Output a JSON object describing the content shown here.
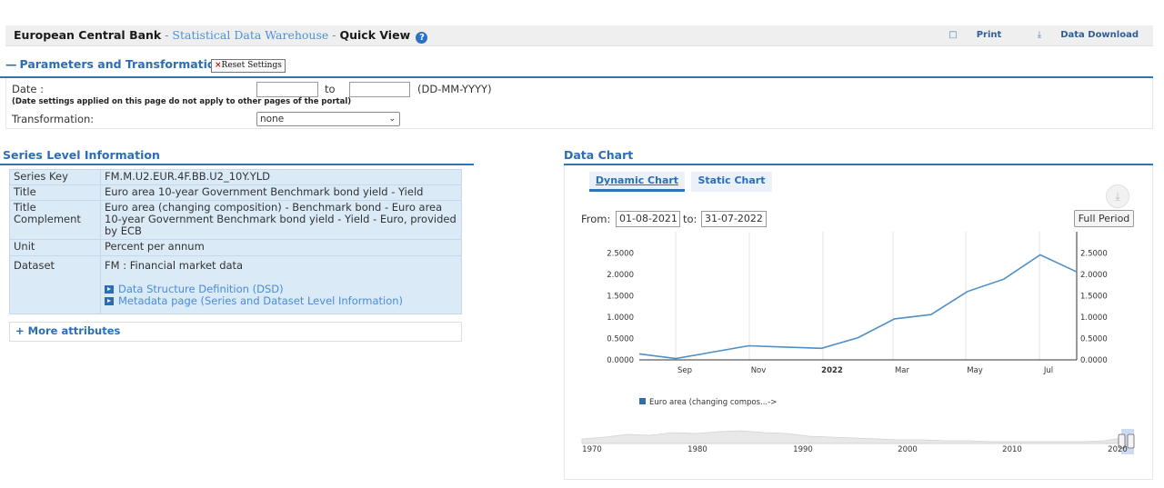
{
  "header": {
    "ecb": "European Central Bank",
    "sep1": " - ",
    "sdw": "Statistical Data Warehouse",
    "sep2": " - ",
    "quick_view": "Quick View",
    "help_glyph": "?",
    "print_label": "Print",
    "download_label": "Data Download"
  },
  "params": {
    "section_title": "Parameters and Transformations",
    "reset_label": "Reset Settings",
    "date_label": "Date :",
    "to_label": "to",
    "date_from_value": "",
    "date_to_value": "",
    "date_format": "(DD-MM-YYYY)",
    "date_note": "(Date settings applied on this page do not apply to other pages of the portal)",
    "transformation_label": "Transformation:",
    "transformation_value": "none"
  },
  "series": {
    "section_title": "Series Level Information",
    "rows": [
      {
        "key": "Series Key",
        "value": "FM.M.U2.EUR.4F.BB.U2_10Y.YLD"
      },
      {
        "key": "Title",
        "value": "Euro area 10-year Government Benchmark bond yield - Yield"
      },
      {
        "key": "Title Complement",
        "value": "Euro area (changing composition) - Benchmark bond - Euro area 10-year Government Benchmark bond yield - Yield - Euro, provided by ECB"
      },
      {
        "key": "Unit",
        "value": "Percent per annum"
      },
      {
        "key": "Dataset",
        "value": "FM : Financial market data"
      }
    ],
    "links": [
      "Data Structure Definition (DSD)",
      "Metadata page (Series and Dataset Level Information)"
    ],
    "more_label": "+ More attributes"
  },
  "chart": {
    "section_title": "Data Chart",
    "tabs": [
      "Dynamic Chart",
      "Static Chart"
    ],
    "from_label": "From:",
    "from_value": "01-08-2021",
    "to_label": "to:",
    "to_value": "31-07-2022",
    "full_period_label": "Full Period",
    "navigator_labels": [
      "1970",
      "1980",
      "1990",
      "2000",
      "2010",
      "2020"
    ]
  },
  "chart_data": {
    "type": "line",
    "x": [
      "2021-08",
      "2021-09",
      "2021-10",
      "2021-11",
      "2021-12",
      "2022-01",
      "2022-02",
      "2022-03",
      "2022-04",
      "2022-05",
      "2022-06",
      "2022-07"
    ],
    "x_tick_labels": [
      "Sep",
      "Nov",
      "2022",
      "Mar",
      "May",
      "Jul"
    ],
    "y_tick_labels": [
      "0.0000",
      "0.5000",
      "1.0000",
      "1.5000",
      "2.0000",
      "2.5000"
    ],
    "ylim": [
      0,
      3
    ],
    "grid": true,
    "legend_position": "bottom-left",
    "series": [
      {
        "name": "Euro area (changing compos...->",
        "color": "#4d8fc6",
        "values": [
          0.14,
          0.03,
          0.18,
          0.33,
          0.3,
          0.27,
          0.52,
          0.96,
          1.06,
          1.6,
          1.89,
          2.46,
          2.06
        ]
      }
    ]
  }
}
